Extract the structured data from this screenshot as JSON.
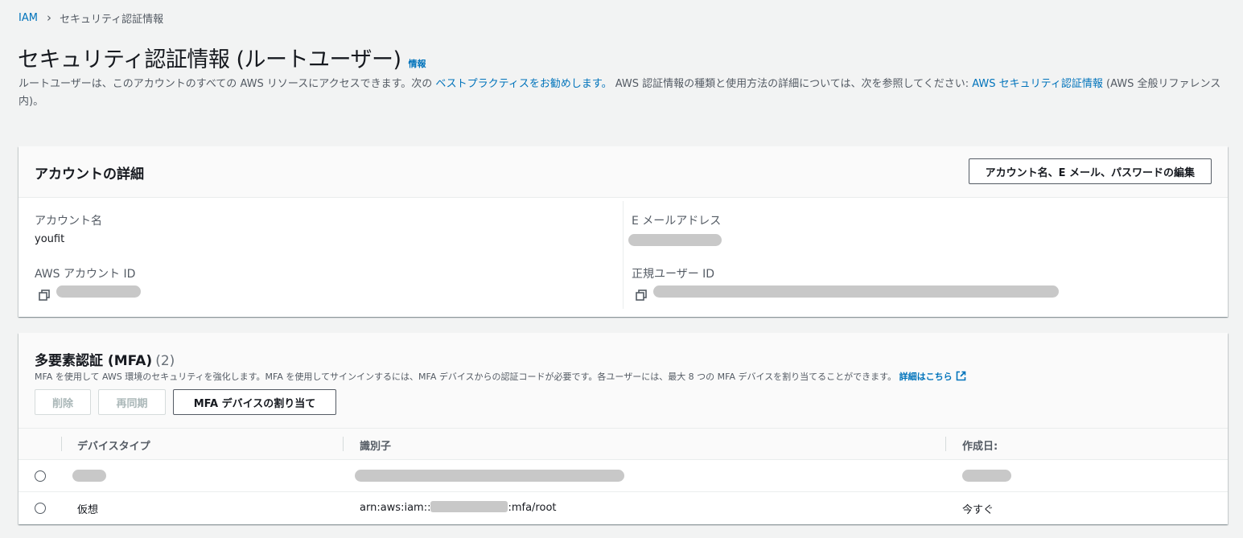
{
  "breadcrumb": {
    "root": "IAM",
    "current": "セキュリティ認証情報"
  },
  "header": {
    "title": "セキュリティ認証情報 (ルートユーザー)",
    "info_link": "情報",
    "desc_1": "ルートユーザーは、このアカウントのすべての AWS リソースにアクセスできます。次の ",
    "desc_link_1": "ベストプラクティスをお勧めします。",
    "desc_2": " AWS 認証情報の種類と使用方法の詳細については、次を参照してください: ",
    "desc_link_2": "AWS セキュリティ認証情報",
    "desc_3": " (AWS 全般リファレンス内)。"
  },
  "account": {
    "title": "アカウントの詳細",
    "edit_button": "アカウント名、E メール、パスワードの編集",
    "name_label": "アカウント名",
    "name_value": "youfit",
    "id_label": "AWS アカウント ID",
    "email_label": "E メールアドレス",
    "canonical_label": "正規ユーザー ID"
  },
  "mfa": {
    "title": "多要素認証 (MFA)",
    "count": "(2)",
    "description": "MFA を使用して AWS 環境のセキュリティを強化します。MFA を使用してサインインするには、MFA デバイスからの認証コードが必要です。各ユーザーには、最大 8 つの MFA デバイスを割り当てることができます。",
    "learn_more": "詳細はこちら",
    "delete_button": "削除",
    "resync_button": "再同期",
    "assign_button": "MFA デバイスの割り当て",
    "columns": {
      "device_type": "デバイスタイプ",
      "identifier": "識別子",
      "created": "作成日:"
    },
    "rows": [
      {
        "device_type": "",
        "identifier": "",
        "created": ""
      },
      {
        "device_type": "仮想",
        "identifier_prefix": "arn:aws:iam::",
        "identifier_suffix": ":mfa/root",
        "created": "今すぐ"
      }
    ]
  }
}
